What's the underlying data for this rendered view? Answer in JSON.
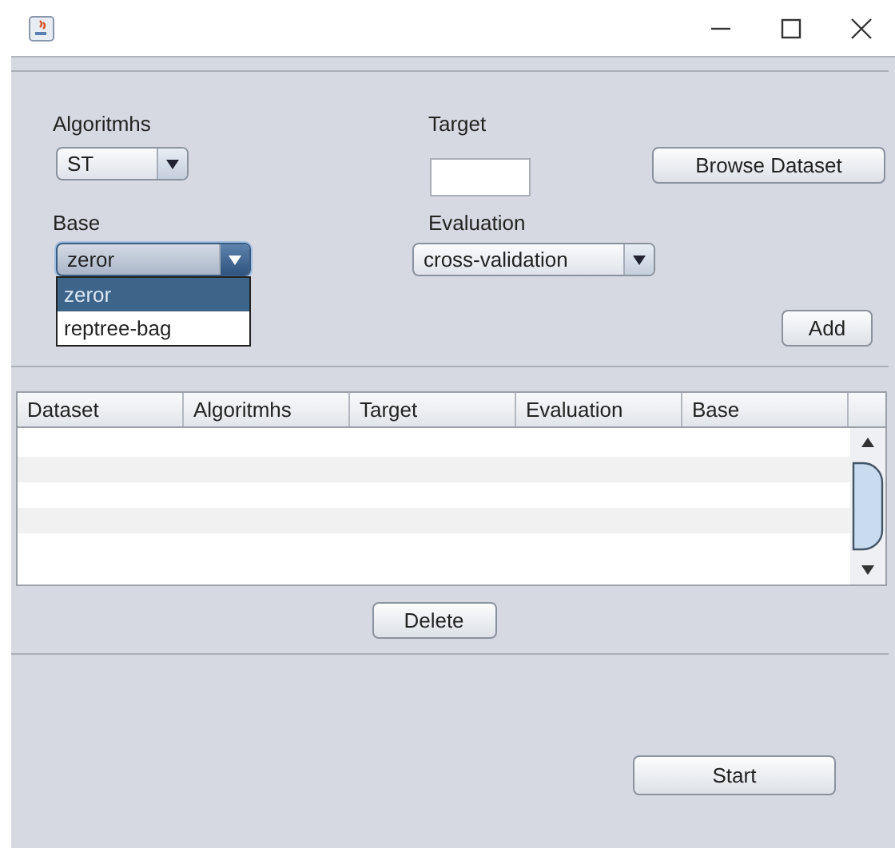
{
  "algorithms": {
    "label": "Algoritmhs",
    "value": "ST"
  },
  "target": {
    "label": "Target"
  },
  "browse_button": "Browse Dataset",
  "base": {
    "label": "Base",
    "value": "zeror",
    "expanded": true,
    "options": [
      {
        "label": "zeror",
        "selected": true
      },
      {
        "label": "reptree-bag",
        "selected": false
      }
    ]
  },
  "evaluation": {
    "label": "Evaluation",
    "value": "cross-validation"
  },
  "add_button": "Add",
  "table": {
    "columns": [
      "Dataset",
      "Algoritmhs",
      "Target",
      "Evaluation",
      "Base"
    ]
  },
  "delete_button": "Delete",
  "start_button": "Start"
}
